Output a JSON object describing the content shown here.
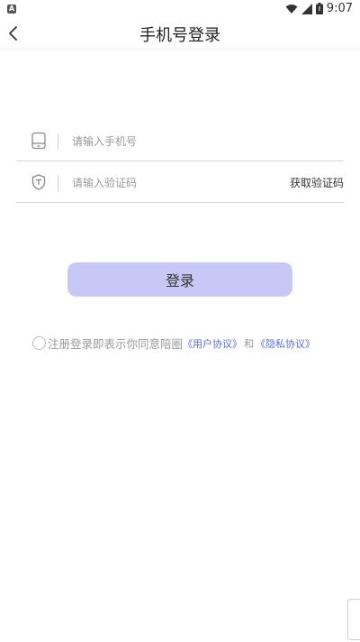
{
  "status_bar": {
    "left_badge": "A",
    "time": "9:07"
  },
  "header": {
    "title": "手机号登录"
  },
  "form": {
    "phone_placeholder": "请输入手机号",
    "code_placeholder": "请输入验证码",
    "get_code_label": "获取验证码"
  },
  "login_button": "登录",
  "agreement": {
    "prefix": "注册登录即表示你同意陪圈",
    "user_agreement": "《用户协议》",
    "and": "和",
    "privacy_policy": "《隐私协议》"
  },
  "colors": {
    "primary_button": "#c8c8f7",
    "link": "#5b6ee1"
  },
  "icons": [
    "back-arrow-icon",
    "wifi-icon",
    "signal-icon",
    "battery-icon",
    "phone-icon",
    "shield-icon"
  ]
}
